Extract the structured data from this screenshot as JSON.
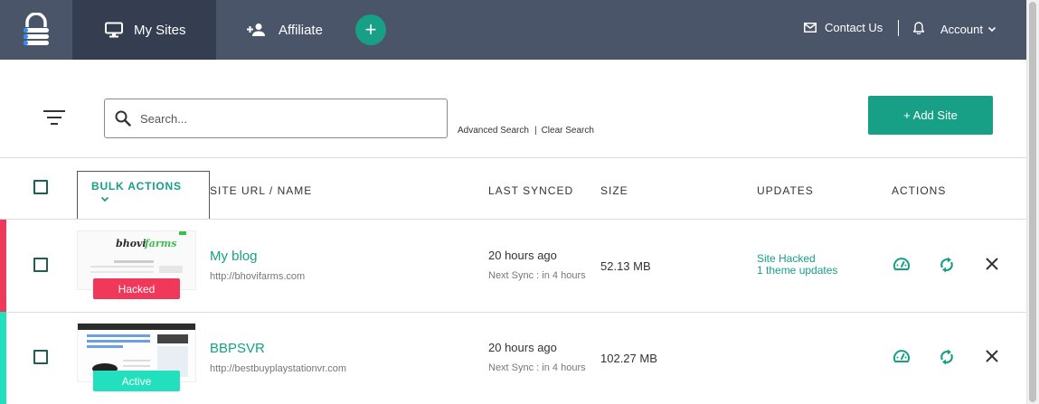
{
  "nav": {
    "tabs": [
      {
        "label": "My Sites",
        "icon": "monitor-icon",
        "active": true
      },
      {
        "label": "Affiliate",
        "icon": "users-add-icon",
        "active": false
      }
    ],
    "add_icon": "+",
    "contact_label": "Contact Us",
    "account_label": "Account"
  },
  "toolbar": {
    "search_placeholder": "Search...",
    "advanced_search": "Advanced Search",
    "separator": "|",
    "clear_search": "Clear Search",
    "add_site_label": "+ Add Site"
  },
  "table": {
    "bulk_actions": "BULK ACTIONS",
    "columns": [
      "SITE URL / NAME",
      "LAST SYNCED",
      "SIZE",
      "UPDATES",
      "ACTIONS"
    ],
    "rows": [
      {
        "name": "My blog",
        "url": "http://bhovifarms.com",
        "last_synced": "20 hours ago",
        "next_sync": "Next Sync : in 4 hours",
        "size": "52.13 MB",
        "updates": [
          "Site Hacked",
          "1 theme updates"
        ],
        "status": "Hacked",
        "status_color": "#f0395a",
        "thumb_logo": "bhovi farms"
      },
      {
        "name": "BBPSVR",
        "url": "http://bestbuyplaystationvr.com",
        "last_synced": "20 hours ago",
        "next_sync": "Next Sync : in 4 hours",
        "size": "102.27 MB",
        "updates": [],
        "status": "Active",
        "status_color": "#22e0be"
      }
    ]
  },
  "colors": {
    "nav_bg": "#4a5569",
    "nav_active": "#343e50",
    "accent": "#17a086"
  }
}
